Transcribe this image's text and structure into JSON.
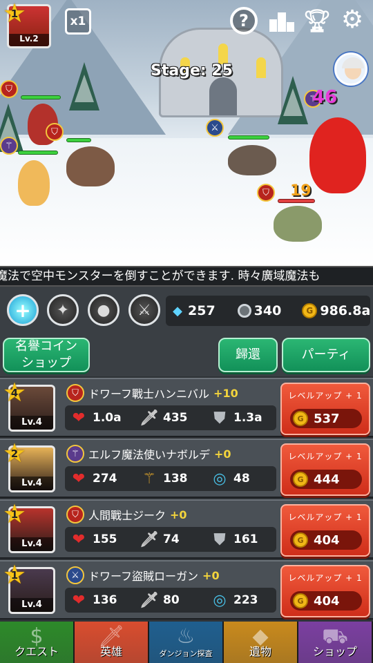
{
  "scene": {
    "stage_label": "Stage: 25",
    "speed_label": "x1",
    "leader": {
      "star": "1",
      "level": "Lv.2"
    },
    "damage_numbers": [
      "46",
      "19"
    ]
  },
  "ticker": {
    "text": "魔法で空中モンスターを倒すことができます. 時々廣域魔法も"
  },
  "currency": {
    "gems": "257",
    "stopwatch": "340",
    "gold": "986.8a"
  },
  "buttons": {
    "honor_shop": "名譽コイン\nショップ",
    "return": "歸還",
    "party": "パーティ"
  },
  "heroes": [
    {
      "star": "4",
      "level": "Lv.4",
      "class_icon": "shield-icon",
      "name": "ドワーフ戰士ハンニバル",
      "bonus": "+10",
      "stats": [
        {
          "icon": "heart-icon",
          "value": "1.0a"
        },
        {
          "icon": "sword-icon",
          "value": "435"
        },
        {
          "icon": "armor-icon",
          "value": "1.3a"
        }
      ],
      "levelup_label": "レベルアップ + 1",
      "cost": "537",
      "portrait_color": "#6b4a3a"
    },
    {
      "star": "2",
      "level": "Lv.4",
      "class_icon": "staff-icon",
      "name": "エルフ魔法使いナボルデ",
      "bonus": "+0",
      "stats": [
        {
          "icon": "heart-icon",
          "value": "274"
        },
        {
          "icon": "staff-icon",
          "value": "138"
        },
        {
          "icon": "ring-icon",
          "value": "48"
        }
      ],
      "levelup_label": "レベルアップ + 1",
      "cost": "444",
      "portrait_color": "#e7b257"
    },
    {
      "star": "1",
      "level": "Lv.4",
      "class_icon": "shield-icon",
      "name": "人間戰士ジーク",
      "bonus": "+0",
      "stats": [
        {
          "icon": "heart-icon",
          "value": "155"
        },
        {
          "icon": "sword-icon",
          "value": "74"
        },
        {
          "icon": "armor-icon",
          "value": "161"
        }
      ],
      "levelup_label": "レベルアップ + 1",
      "cost": "404",
      "portrait_color": "#b8332c"
    },
    {
      "star": "1",
      "level": "Lv.4",
      "class_icon": "crossed-swords-icon",
      "name": "ドワーフ盜賊ローガン",
      "bonus": "+0",
      "stats": [
        {
          "icon": "heart-icon",
          "value": "136"
        },
        {
          "icon": "sword-icon",
          "value": "80"
        },
        {
          "icon": "ring-icon",
          "value": "223"
        }
      ],
      "levelup_label": "レベルアップ + 1",
      "cost": "404",
      "portrait_color": "#4a3a4e"
    }
  ],
  "nav": [
    {
      "label": "クエスト",
      "color": "#2d8a2a",
      "icon": "money-bag-icon"
    },
    {
      "label": "英雄",
      "color": "#d94d2f",
      "icon": "sword-icon"
    },
    {
      "label": "ダンジョン探査",
      "color": "#1f5f8f",
      "icon": "torch-icon"
    },
    {
      "label": "遺物",
      "color": "#c98a1d",
      "icon": "gem-icon"
    },
    {
      "label": "ショップ",
      "color": "#7b3fa0",
      "icon": "cart-icon"
    }
  ],
  "colors": {
    "accent_green": "#1ea868",
    "levelup_red": "#e0452b",
    "gold": "#f1b717"
  }
}
